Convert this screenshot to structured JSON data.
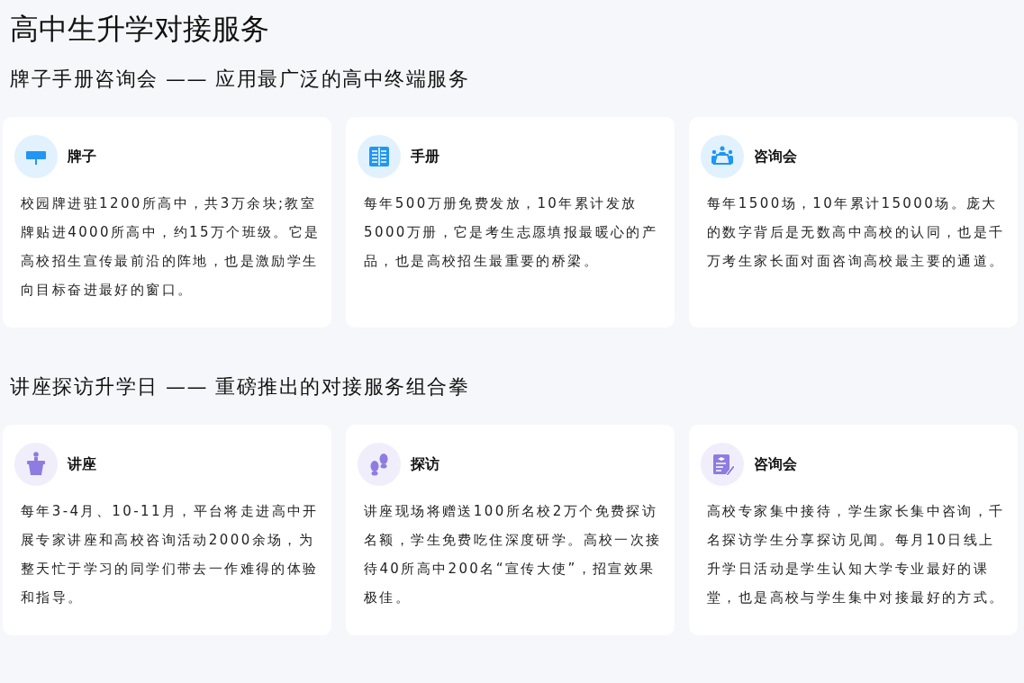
{
  "title": "高中生升学对接服务",
  "sections": [
    {
      "heading": "牌子手册咨询会 —— 应用最广泛的高中终端服务",
      "color": "#2196f3",
      "cards": [
        {
          "kind": "sign",
          "title": "牌子",
          "text": "校园牌进驻1200所高中，共3万余块;教室牌贴进4000所高中，约15万个班级。它是高校招生宣传最前沿的阵地，也是激励学生向目标奋进最好的窗口。"
        },
        {
          "kind": "booklet",
          "title": "手册",
          "text": "每年500万册免费发放，10年累计发放5000万册，它是考生志愿填报最暖心的产品，也是高校招生最重要的桥梁。"
        },
        {
          "kind": "meeting",
          "title": "咨询会",
          "text": "每年1500场，10年累计15000场。庞大的数字背后是无数高中高校的认同，也是千万考生家长面对面咨询高校最主要的通道。"
        }
      ]
    },
    {
      "heading": "讲座探访升学日 —— 重磅推出的对接服务组合拳",
      "color": "#8e7ce0",
      "cards": [
        {
          "kind": "podium",
          "title": "讲座",
          "text": "每年3-4月、10-11月，平台将走进高中开展专家讲座和高校咨询活动2000余场，为整天忙于学习的同学们带去一作难得的体验和指导。"
        },
        {
          "kind": "footprints",
          "title": "探访",
          "text": "讲座现场将赠送100所名校2万个免费探访名额，学生免费吃住深度研学。高校一次接待40所高中200名“宣传大使”，招宣效果极佳。"
        },
        {
          "kind": "certificate",
          "title": "咨询会",
          "text": "高校专家集中接待，学生家长集中咨询，千名探访学生分享探访见闻。每月10日线上升学日活动是学生认知大学专业最好的课堂，也是高校与学生集中对接最好的方式。"
        }
      ]
    }
  ]
}
